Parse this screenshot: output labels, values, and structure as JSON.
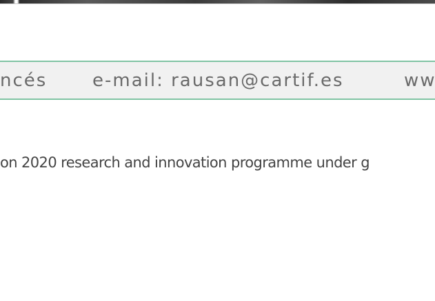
{
  "contact_bar": {
    "name_fragment": "ncés",
    "email": "e-mail: rausan@cartif.es",
    "web_fragment": "ww"
  },
  "funding": {
    "text": "on 2020 research and innovation programme under g"
  },
  "colors": {
    "bar_border": "#7fc3a3",
    "bar_background": "#f1f1f1",
    "contact_text": "#6a6a6a",
    "body_text": "#444444"
  }
}
